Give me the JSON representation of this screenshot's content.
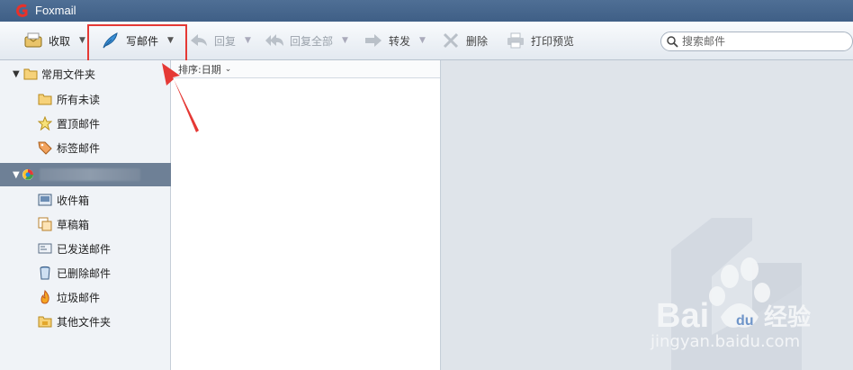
{
  "app": {
    "title": "Foxmail"
  },
  "toolbar": {
    "receive_label": "收取",
    "compose_label": "写邮件",
    "reply_label": "回复",
    "reply_all_label": "回复全部",
    "forward_label": "转发",
    "delete_label": "删除",
    "print_preview_label": "打印预览"
  },
  "search": {
    "placeholder": "搜索邮件"
  },
  "sidebar": {
    "common_folders_label": "常用文件夹",
    "common_items": [
      {
        "label": "所有未读",
        "icon": "folder-icon"
      },
      {
        "label": "置顶邮件",
        "icon": "star-icon"
      },
      {
        "label": "标签邮件",
        "icon": "tag-icon"
      }
    ],
    "account_items": [
      {
        "label": "收件箱",
        "icon": "inbox-icon"
      },
      {
        "label": "草稿箱",
        "icon": "drafts-icon"
      },
      {
        "label": "已发送邮件",
        "icon": "sent-icon"
      },
      {
        "label": "已删除邮件",
        "icon": "trash-icon"
      },
      {
        "label": "垃圾邮件",
        "icon": "junk-icon"
      },
      {
        "label": "其他文件夹",
        "icon": "other-folder-icon"
      }
    ]
  },
  "list": {
    "sort_label": "排序:日期"
  },
  "watermark": {
    "brand": "Bai",
    "brand2": "du",
    "brand_cn": "经验",
    "url": "jingyan.baidu.com"
  },
  "colors": {
    "title_bar": "#466892",
    "highlight": "#e53935",
    "account_bar": "#6e8096"
  }
}
